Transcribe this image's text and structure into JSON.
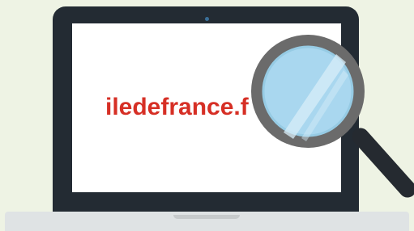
{
  "screen": {
    "text": "iledefrance.f"
  },
  "colors": {
    "background": "#eef3e4",
    "laptop_bezel": "#232b33",
    "screen": "#ffffff",
    "text": "#d62f25",
    "base": "#dfe3e4",
    "magnifier_ring": "#6b6b6b",
    "magnifier_lens": "#a9d7ef",
    "magnifier_handle": "#252a30"
  },
  "icons": {
    "device": "laptop-icon",
    "search": "magnifying-glass-icon"
  }
}
